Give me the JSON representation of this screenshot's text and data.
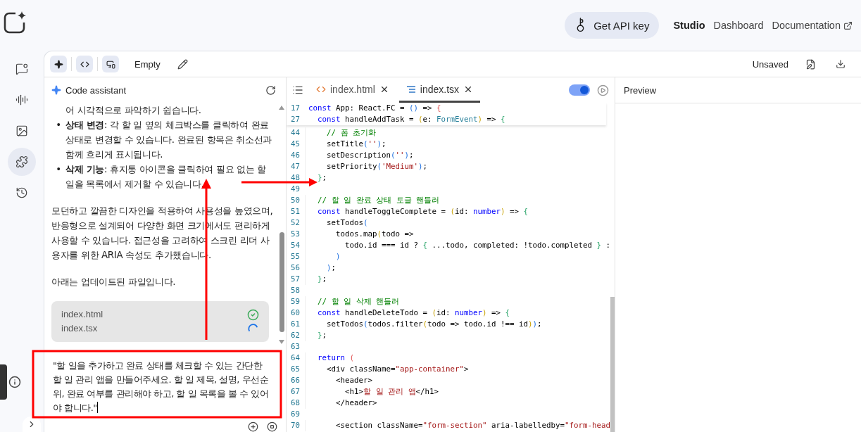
{
  "header": {
    "api_button": "Get API key",
    "nav": [
      {
        "label": "Studio",
        "selected": true,
        "external": false
      },
      {
        "label": "Dashboard",
        "selected": false,
        "external": false
      },
      {
        "label": "Documentation",
        "selected": false,
        "external": true
      }
    ]
  },
  "rail": [
    {
      "kind": "chat",
      "selected": false
    },
    {
      "kind": "audio",
      "selected": false
    },
    {
      "kind": "image",
      "selected": false
    },
    {
      "kind": "puzzle",
      "selected": true
    },
    {
      "kind": "history",
      "selected": false
    }
  ],
  "toolbar": {
    "title": "Empty",
    "status": "Unsaved"
  },
  "chat": {
    "title": "Code assistant",
    "messages": [
      {
        "kind": "continuation",
        "text": "어 시각적으로 파악하기 쉽습니다."
      },
      {
        "kind": "bullet",
        "marker": "•",
        "text": "**상태 변경**: 각 할 일 옆의 체크박스를 클릭하여 완료 상태로 변경할 수 있습니다. 완료된 항목은 취소선과 함께 흐리게 표시됩니다."
      },
      {
        "kind": "bullet",
        "marker": "•",
        "text": "**삭제 기능**: 휴지통 아이콘을 클릭하여 필요 없는 할 일을 목록에서 제거할 수 있습니다."
      },
      {
        "kind": "paragraph",
        "text": "모던하고 깔끔한 디자인을 적용하여 사용성을 높였으며, 반응형으로 설계되어 다양한 화면 크기에서도 편리하게 사용할 수 있습니다. 접근성을 고려하여 스크린 리더 사용자를 위한 ARIA 속성도 추가했습니다."
      },
      {
        "kind": "paragraph",
        "text": "아래는 업데이트된 파일입니다."
      }
    ],
    "files": [
      {
        "name": "index.html",
        "done": true
      },
      {
        "name": "index.tsx",
        "done": false
      }
    ],
    "input": "\"할 일을 추가하고 완료 상태를 체크할 수 있는 간단한 할 일 관리 앱을 만들어주세요. 할 일 제목, 설명, 우선순위, 완료 여부를 관리해야 하고, 할 일 목록을 볼 수 있어야 합니다.\""
  },
  "editor": {
    "tabs": [
      {
        "label": "index.html",
        "kind": "html",
        "selected": false
      },
      {
        "label": "index.tsx",
        "kind": "tsx",
        "selected": true
      }
    ],
    "toggle": {
      "on": true
    },
    "sticky": [
      {
        "number": "17",
        "tokens": [
          {
            "kind": "kw",
            "text": "const"
          },
          {
            "kind": "plain",
            "text": " App: React.FC = "
          },
          {
            "kind": "b3",
            "text": "()"
          },
          {
            "kind": "plain",
            "text": " => "
          },
          {
            "kind": "b4",
            "text": "{"
          }
        ]
      },
      {
        "number": "27",
        "tokens": [
          {
            "kind": "kw",
            "text": "  const"
          },
          {
            "kind": "plain",
            "text": " handleAddTask = "
          },
          {
            "kind": "b1",
            "text": "("
          },
          {
            "kind": "plain",
            "text": "e: "
          },
          {
            "kind": "type",
            "text": "FormEvent"
          },
          {
            "kind": "b1",
            "text": ")"
          },
          {
            "kind": "plain",
            "text": " => "
          },
          {
            "kind": "b2",
            "text": "{"
          }
        ]
      }
    ],
    "lines": [
      {
        "number": "44",
        "tokens": [
          {
            "kind": "comment",
            "text": "    // 폼 초기화"
          }
        ]
      },
      {
        "number": "45",
        "tokens": [
          {
            "kind": "plain",
            "text": "    setTitle"
          },
          {
            "kind": "b3",
            "text": "("
          },
          {
            "kind": "str",
            "text": "''"
          },
          {
            "kind": "b3",
            "text": ")"
          },
          {
            "kind": "plain",
            "text": ";"
          }
        ]
      },
      {
        "number": "46",
        "tokens": [
          {
            "kind": "plain",
            "text": "    setDescription"
          },
          {
            "kind": "b3",
            "text": "("
          },
          {
            "kind": "str",
            "text": "''"
          },
          {
            "kind": "b3",
            "text": ")"
          },
          {
            "kind": "plain",
            "text": ";"
          }
        ]
      },
      {
        "number": "47",
        "tokens": [
          {
            "kind": "plain",
            "text": "    setPriority"
          },
          {
            "kind": "b3",
            "text": "("
          },
          {
            "kind": "str",
            "text": "'Medium'"
          },
          {
            "kind": "b3",
            "text": ")"
          },
          {
            "kind": "plain",
            "text": ";"
          }
        ]
      },
      {
        "number": "48",
        "tokens": [
          {
            "kind": "b2",
            "text": "  }"
          },
          {
            "kind": "plain",
            "text": ";"
          }
        ]
      },
      {
        "number": "49"
      },
      {
        "number": "50",
        "tokens": [
          {
            "kind": "comment",
            "text": "  // 할 일 완료 상태 토글 핸들러"
          }
        ]
      },
      {
        "number": "51",
        "tokens": [
          {
            "kind": "kw",
            "text": "  const"
          },
          {
            "kind": "plain",
            "text": " handleToggleComplete = "
          },
          {
            "kind": "b1",
            "text": "("
          },
          {
            "kind": "plain",
            "text": "id: "
          },
          {
            "kind": "kw",
            "text": "number"
          },
          {
            "kind": "b1",
            "text": ")"
          },
          {
            "kind": "plain",
            "text": " => "
          },
          {
            "kind": "b2",
            "text": "{"
          }
        ]
      },
      {
        "number": "52",
        "tokens": [
          {
            "kind": "plain",
            "text": "    setTodos"
          },
          {
            "kind": "b3",
            "text": "("
          }
        ]
      },
      {
        "number": "53",
        "tokens": [
          {
            "kind": "plain",
            "text": "      todos.map"
          },
          {
            "kind": "b1",
            "text": "("
          },
          {
            "kind": "plain",
            "text": "todo =>"
          }
        ]
      },
      {
        "number": "54",
        "tokens": [
          {
            "kind": "plain",
            "text": "        todo.id === id ? "
          },
          {
            "kind": "b2",
            "text": "{"
          },
          {
            "kind": "plain",
            "text": " ...todo, completed: !todo.completed "
          },
          {
            "kind": "b2",
            "text": "}"
          },
          {
            "kind": "plain",
            "text": " :"
          }
        ]
      },
      {
        "number": "55",
        "tokens": [
          {
            "kind": "b3",
            "text": "      )"
          }
        ]
      },
      {
        "number": "56",
        "tokens": [
          {
            "kind": "b3",
            "text": "    )"
          },
          {
            "kind": "plain",
            "text": ";"
          }
        ]
      },
      {
        "number": "57",
        "tokens": [
          {
            "kind": "b2",
            "text": "  }"
          },
          {
            "kind": "plain",
            "text": ";"
          }
        ]
      },
      {
        "number": "58"
      },
      {
        "number": "59",
        "tokens": [
          {
            "kind": "comment",
            "text": "  // 할 일 삭제 핸들러"
          }
        ]
      },
      {
        "number": "60",
        "tokens": [
          {
            "kind": "kw",
            "text": "  const"
          },
          {
            "kind": "plain",
            "text": " handleDeleteTodo = "
          },
          {
            "kind": "b1",
            "text": "("
          },
          {
            "kind": "plain",
            "text": "id: "
          },
          {
            "kind": "kw",
            "text": "number"
          },
          {
            "kind": "b1",
            "text": ")"
          },
          {
            "kind": "plain",
            "text": " => "
          },
          {
            "kind": "b2",
            "text": "{"
          }
        ]
      },
      {
        "number": "61",
        "tokens": [
          {
            "kind": "plain",
            "text": "    setTodos"
          },
          {
            "kind": "b3",
            "text": "("
          },
          {
            "kind": "plain",
            "text": "todos.filter"
          },
          {
            "kind": "b1",
            "text": "("
          },
          {
            "kind": "plain",
            "text": "todo => todo.id !== id"
          },
          {
            "kind": "b1",
            "text": ")"
          },
          {
            "kind": "b3",
            "text": ")"
          },
          {
            "kind": "plain",
            "text": ";"
          }
        ]
      },
      {
        "number": "62",
        "tokens": [
          {
            "kind": "b2",
            "text": "  }"
          },
          {
            "kind": "plain",
            "text": ";"
          }
        ]
      },
      {
        "number": "63"
      },
      {
        "number": "64",
        "tokens": [
          {
            "kind": "kw",
            "text": "  return"
          },
          {
            "kind": "b4",
            "text": " ("
          }
        ]
      },
      {
        "number": "65",
        "tokens": [
          {
            "kind": "plain",
            "text": "    <div className="
          },
          {
            "kind": "str",
            "text": "\"app-container\""
          },
          {
            "kind": "plain",
            "text": ">"
          }
        ]
      },
      {
        "number": "66",
        "tokens": [
          {
            "kind": "plain",
            "text": "      <header>"
          }
        ]
      },
      {
        "number": "67",
        "tokens": [
          {
            "kind": "plain",
            "text": "        <h1>"
          },
          {
            "kind": "str",
            "text": "할 일 관리 앱"
          },
          {
            "kind": "plain",
            "text": "</h1>"
          }
        ]
      },
      {
        "number": "68",
        "tokens": [
          {
            "kind": "plain",
            "text": "      </header>"
          }
        ]
      },
      {
        "number": "69"
      },
      {
        "number": "70",
        "tokens": [
          {
            "kind": "plain",
            "text": "      <section className="
          },
          {
            "kind": "str",
            "text": "\"form-section\""
          },
          {
            "kind": "plain",
            "text": " aria-labelledby="
          },
          {
            "kind": "str",
            "text": "\"form-head"
          }
        ]
      }
    ]
  },
  "preview": {
    "title": "Preview"
  },
  "annotations": [
    {
      "kind": "box"
    },
    {
      "kind": "arrow"
    },
    {
      "kind": "arrow"
    }
  ]
}
